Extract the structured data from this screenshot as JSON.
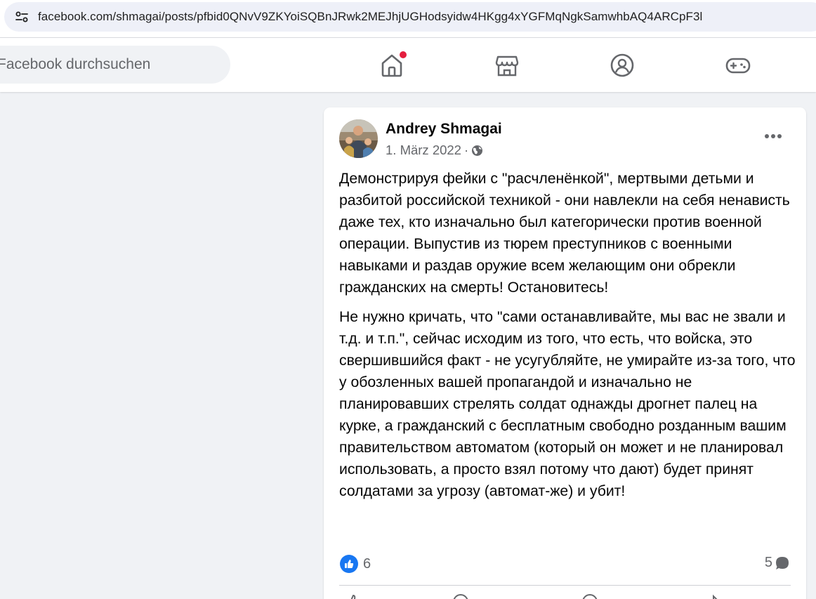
{
  "browser": {
    "url": "facebook.com/shmagai/posts/pfbid0QNvV9ZKYoiSQBnJRwk2MEJhjUGHodsyidw4HKgg4xYGFMqNgkSamwhbAQ4ARCpF3l"
  },
  "facebook_nav": {
    "search_placeholder": "Facebook durchsuchen",
    "tabs": [
      {
        "icon": "home-icon",
        "has_notification": true
      },
      {
        "icon": "marketplace-icon",
        "has_notification": false
      },
      {
        "icon": "groups-icon",
        "has_notification": false
      },
      {
        "icon": "gaming-icon",
        "has_notification": false
      }
    ],
    "notification_color": "#e41e3f"
  },
  "post": {
    "author": "Andrey Shmagai",
    "date": "1. März 2022",
    "separator": "·",
    "audience_icon": "globe-icon",
    "paragraphs": [
      "Демонстрируя фейки с \"расчленёнкой\", мертвыми детьми и разбитой российской техникой - они навлекли на себя ненависть даже тех, кто изначально был категорически против военной операции. Выпустив из тюрем преступников с военными навыками и раздав оружие всем желающим они обрекли гражданских на смерть! Остановитесь!",
      "Не нужно кричать, что \"сами останавливайте, мы вас не звали и т.д. и т.п.\", сейчас исходим из того, что есть, что войска, это свершившийся факт - не усугубляйте, не умирайте из-за того, что у обозленных вашей пропагандой и изначально не планировавших стрелять солдат однажды дрогнет палец на курке, а гражданский с бесплатным свободно розданным вашим правительством автоматом (который он может и не планировал использовать, а просто взял потому что дают) будет принят солдатами за угрозу (автомат-же) и убит!"
    ],
    "reaction_count": "6",
    "comment_count": "5",
    "like_color": "#1877f2"
  }
}
